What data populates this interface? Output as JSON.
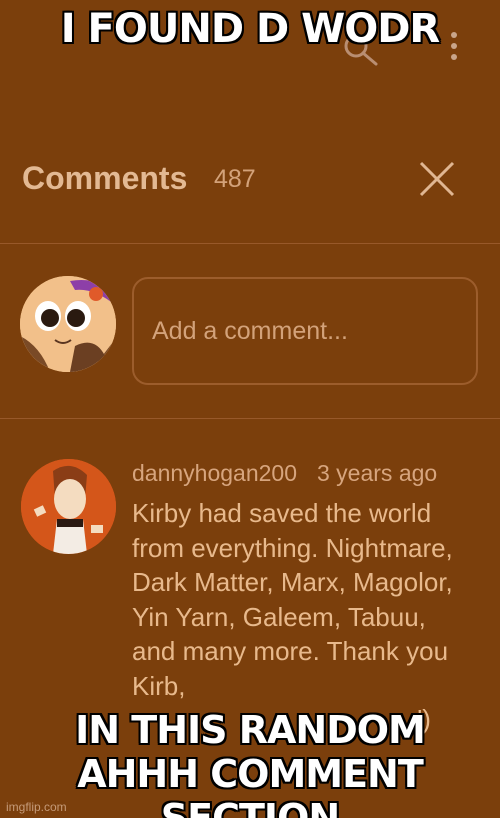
{
  "meme": {
    "top_caption": "I FOUND D WODR",
    "bottom_caption_line1": "IN THIS RANDOM",
    "bottom_caption_line2": "AHHH COMMENT SECTION"
  },
  "comments_panel": {
    "title": "Comments",
    "count": "487",
    "add_comment_placeholder": "Add a comment...",
    "comment": {
      "username": "dannyhogan200",
      "time_ago": "3 years ago",
      "text": "Kirby had saved the world from everything. Nightmare, Dark Matter, Marx, Magolor, Yin Yarn, Galeem, Tabuu, and many more. Thank you Kirb,",
      "partial_tail": ":')"
    }
  },
  "icons": {
    "search": "search-icon",
    "menu": "kebab-menu-icon",
    "close": "close-icon",
    "avatar_self": "avatar",
    "avatar_commenter": "avatar"
  },
  "watermark": "imgflip.com",
  "colors": {
    "background": "#7b3f0c",
    "text": "#e8b98c",
    "caption_fill": "#ffffff",
    "caption_outline": "#000000"
  }
}
